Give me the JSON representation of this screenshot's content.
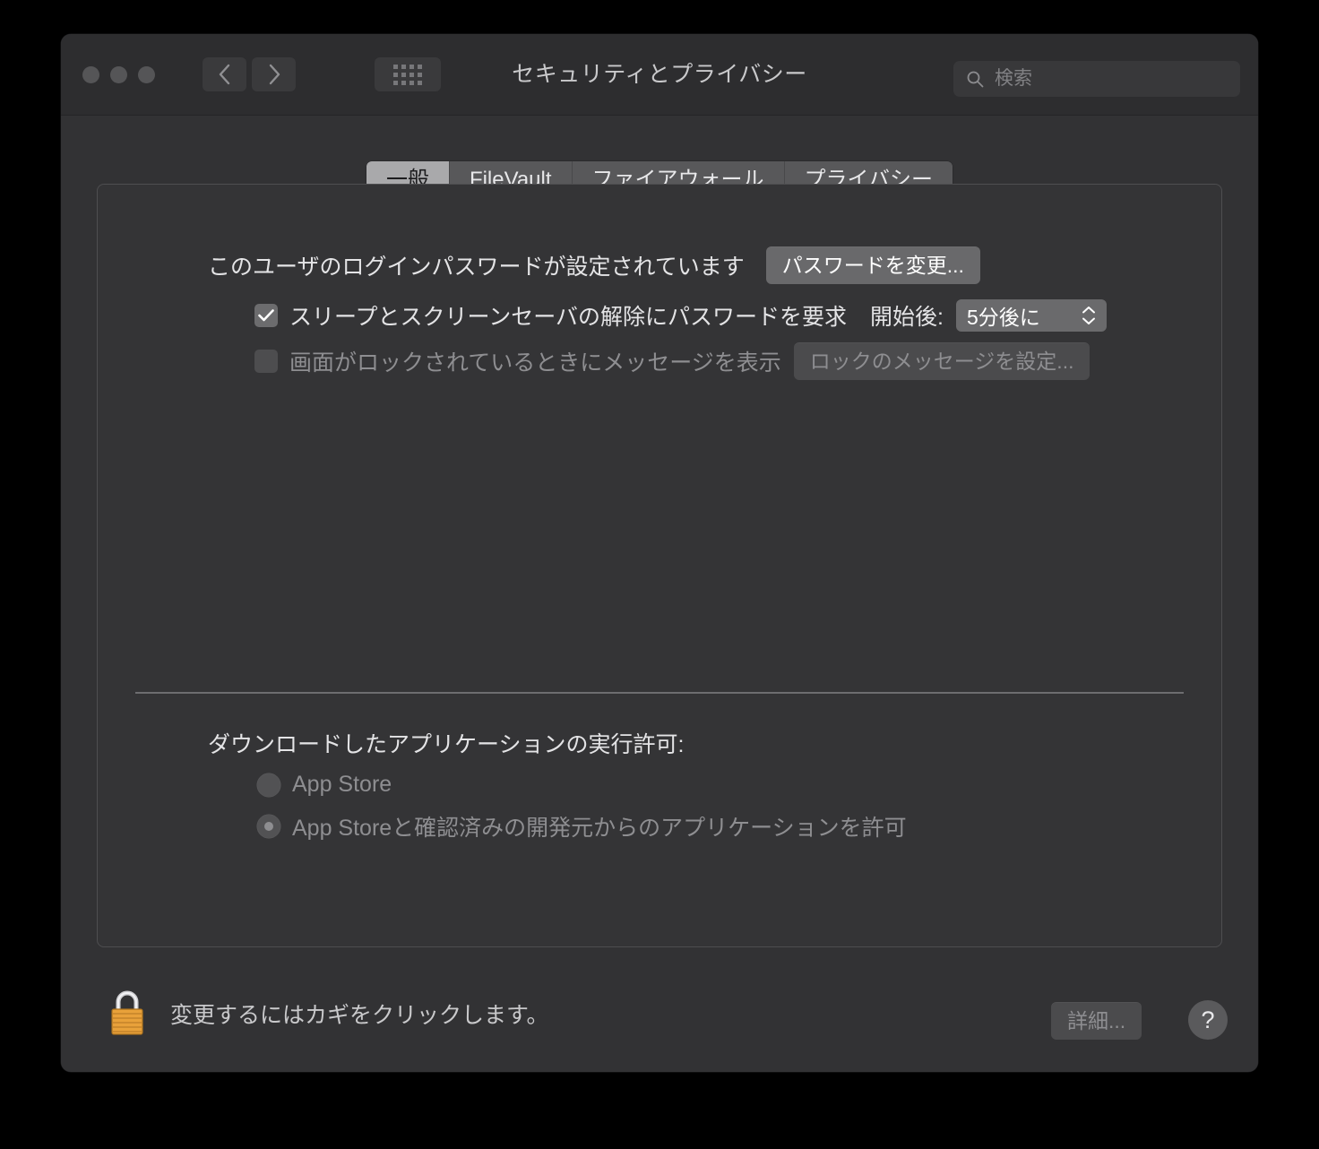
{
  "window": {
    "title": "セキュリティとプライバシー",
    "traffic_lights": [
      "close-button",
      "minimize-button",
      "zoom-button"
    ],
    "nav": {
      "back": "back-button",
      "forward": "forward-button",
      "show_all": "show-all-button"
    }
  },
  "search": {
    "placeholder": "検索",
    "value": ""
  },
  "tabs": [
    {
      "label": "一般",
      "selected": true
    },
    {
      "label": "FileVault",
      "selected": false
    },
    {
      "label": "ファイアウォール",
      "selected": false
    },
    {
      "label": "プライバシー",
      "selected": false
    }
  ],
  "general": {
    "password_status": "このユーザのログインパスワードが設定されています",
    "change_password_button": "パスワードを変更...",
    "require_password": {
      "label": "スリープとスクリーンセーバの解除にパスワードを要求",
      "checked": true,
      "delay_label": "開始後:",
      "delay_value": "5分後に"
    },
    "show_message": {
      "label": "画面がロックされているときにメッセージを表示",
      "checked": false,
      "button": "ロックのメッセージを設定..."
    },
    "gatekeeper": {
      "heading": "ダウンロードしたアプリケーションの実行許可:",
      "options": [
        {
          "label": "App Store",
          "selected": false
        },
        {
          "label": "App Storeと確認済みの開発元からのアプリケーションを許可",
          "selected": true
        }
      ]
    }
  },
  "footer": {
    "lock_icon": "lock-closed-icon",
    "lock_text": "変更するにはカギをクリックします。",
    "advanced_button": "詳細...",
    "help_button": "?"
  },
  "colors": {
    "window_bg": "#323234",
    "titlebar_bg": "#2d2d2f",
    "panel_bg": "#343436",
    "selected_tab_bg": "#a9a9ab",
    "tab_bg": "#58585a",
    "button_bg": "#69696b",
    "disabled_text": "#8e8e91",
    "text": "#e4e4e6",
    "lock_gold": "#e8a13a"
  }
}
